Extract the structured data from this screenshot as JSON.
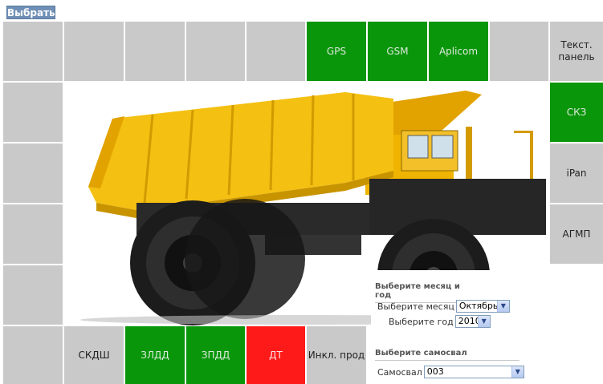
{
  "toolbar": {
    "select_label": "Выбрать"
  },
  "top_row": [
    {
      "label": "",
      "state": "grey"
    },
    {
      "label": "",
      "state": "grey"
    },
    {
      "label": "",
      "state": "grey"
    },
    {
      "label": "",
      "state": "grey"
    },
    {
      "label": "",
      "state": "grey"
    },
    {
      "label": "GPS",
      "state": "green"
    },
    {
      "label": "GSM",
      "state": "green"
    },
    {
      "label": "Aplicom",
      "state": "green"
    },
    {
      "label": "",
      "state": "grey"
    },
    {
      "label": "Текст. панель",
      "state": "grey"
    }
  ],
  "right_column": [
    {
      "label": "СКЗ",
      "state": "green"
    },
    {
      "label": "iPan",
      "state": "grey"
    },
    {
      "label": "АГМП",
      "state": "grey"
    }
  ],
  "bottom_row": [
    {
      "label": "",
      "state": "grey"
    },
    {
      "label": "СКДШ",
      "state": "grey"
    },
    {
      "label": "ЗЛДД",
      "state": "green"
    },
    {
      "label": "ЗПДД",
      "state": "green"
    },
    {
      "label": "ДТ",
      "state": "red"
    },
    {
      "label": "Инкл. прод",
      "state": "grey"
    }
  ],
  "form": {
    "period_heading": "Выберите месяц и год",
    "month_label": "Выберите месяц",
    "month_value": "Октябрь",
    "year_label": "Выберите год",
    "year_value": "2010",
    "truck_heading": "Выберите самосвал",
    "truck_label": "Самосвал",
    "truck_value": "003"
  },
  "colors": {
    "green": "#0a960a",
    "red": "#ff1a1a",
    "grey": "#c9c9c9",
    "button": "#6f8fb6"
  },
  "icons": {
    "dropdown": "chevron-down-icon"
  }
}
